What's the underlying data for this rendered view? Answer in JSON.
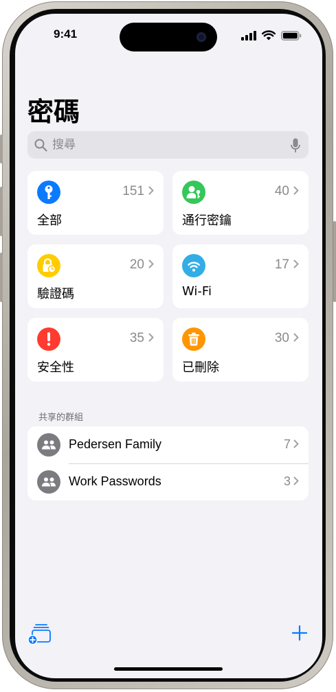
{
  "status_bar": {
    "time": "9:41"
  },
  "page": {
    "title": "密碼"
  },
  "search": {
    "placeholder": "搜尋"
  },
  "categories": [
    {
      "label": "全部",
      "count": "151",
      "icon": "key-icon",
      "color": "#0a7aff"
    },
    {
      "label": "通行密鑰",
      "count": "40",
      "icon": "passkey-person-icon",
      "color": "#34c759"
    },
    {
      "label": "驗證碼",
      "count": "20",
      "icon": "lock-clock-icon",
      "color": "#ffcc00"
    },
    {
      "label": "Wi-Fi",
      "count": "17",
      "icon": "wifi-icon",
      "color": "#32ade6"
    },
    {
      "label": "安全性",
      "count": "35",
      "icon": "exclamation-icon",
      "color": "#ff3b30"
    },
    {
      "label": "已刪除",
      "count": "30",
      "icon": "trash-icon",
      "color": "#ff9500"
    }
  ],
  "shared_groups": {
    "header": "共享的群組",
    "items": [
      {
        "name": "Pedersen Family",
        "count": "7",
        "icon": "group-people-icon"
      },
      {
        "name": "Work Passwords",
        "count": "3",
        "icon": "group-people-icon"
      }
    ]
  },
  "toolbar": {
    "left_icon": "new-group-icon",
    "right_icon": "plus-icon",
    "accent": "#0a7aff"
  }
}
